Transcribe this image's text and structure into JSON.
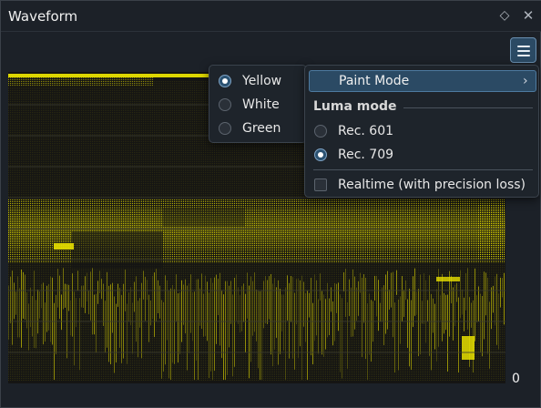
{
  "window": {
    "title": "Waveform",
    "float_icon": "◇",
    "close_icon": "✕"
  },
  "scope": {
    "zero_label": "0"
  },
  "paint_submenu": {
    "options": [
      {
        "label": "Yellow",
        "checked": true
      },
      {
        "label": "White",
        "checked": false
      },
      {
        "label": "Green",
        "checked": false
      }
    ]
  },
  "main_menu": {
    "paint_mode_label": "Paint Mode",
    "chevron": "›",
    "luma_mode_title": "Luma mode",
    "luma_options": [
      {
        "label": "Rec. 601",
        "checked": false
      },
      {
        "label": "Rec. 709",
        "checked": true
      }
    ],
    "realtime_label": "Realtime (with precision loss)",
    "realtime_checked": false
  },
  "colors": {
    "trace": "#e8e000",
    "accent": "#2b4a64"
  }
}
